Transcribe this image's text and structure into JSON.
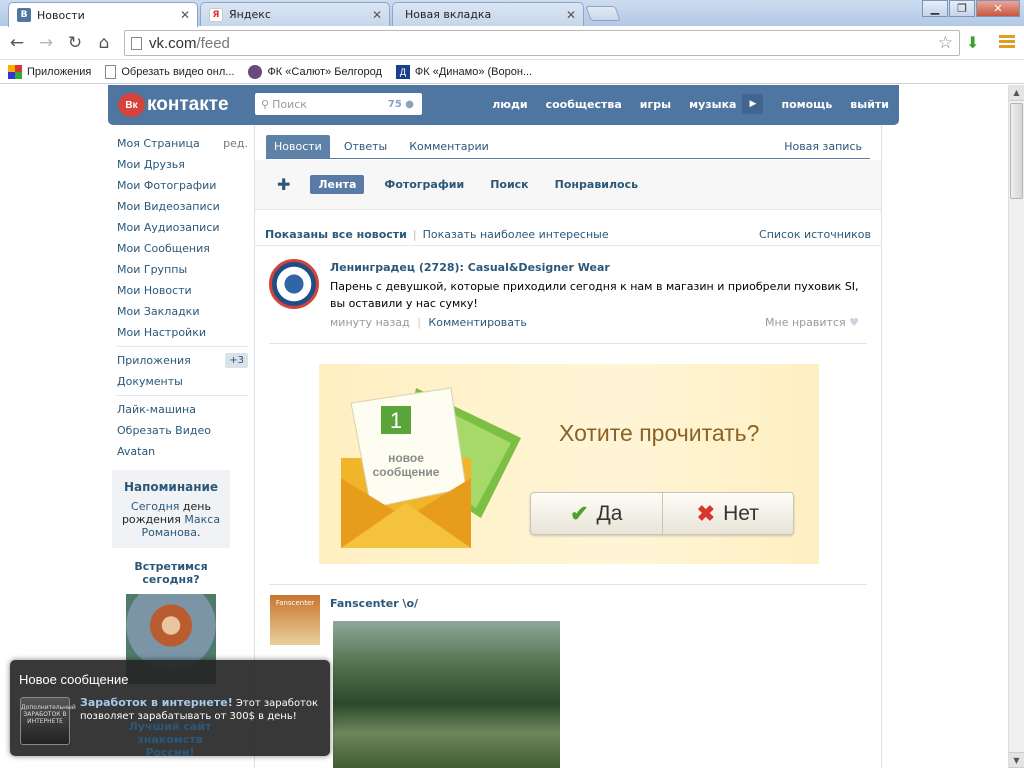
{
  "browser": {
    "tabs": [
      {
        "title": "Новости",
        "favicon": "vk-icon",
        "active": true
      },
      {
        "title": "Яндекс",
        "favicon": "yandex-icon",
        "active": false
      },
      {
        "title": "Новая вкладка",
        "favicon": "",
        "active": false
      }
    ],
    "url_host": "vk.com",
    "url_path": "/feed",
    "bookmarks": [
      {
        "label": "Приложения",
        "icon": "apps-grid-icon"
      },
      {
        "label": "Обрезать видео онл...",
        "icon": "page-icon"
      },
      {
        "label": "ФК «Салют» Белгород",
        "icon": "club-icon"
      },
      {
        "label": "ФК «Динамо» (Ворон...",
        "icon": "dynamo-icon"
      }
    ]
  },
  "vk": {
    "logo_text": "контакте",
    "logo_badge": "Вк",
    "search": {
      "placeholder": "Поиск",
      "count": "75"
    },
    "nav": [
      "люди",
      "сообщества",
      "игры",
      "музыка",
      "помощь",
      "выйти"
    ],
    "left_menu": {
      "primary": [
        "Моя Страница",
        "Мои Друзья",
        "Мои Фотографии",
        "Мои Видеозаписи",
        "Мои Аудиозаписи",
        "Мои Сообщения",
        "Мои Группы",
        "Мои Новости",
        "Мои Закладки",
        "Мои Настройки"
      ],
      "edit_label": "ред.",
      "apps_label": "Приложения",
      "apps_badge": "+3",
      "docs_label": "Документы",
      "extra": [
        "Лайк-машина",
        "Обрезать Видео",
        "Avatan"
      ]
    },
    "reminder": {
      "title": "Напоминание",
      "text_pre": "Сегодня",
      "text_mid": "день рождения",
      "name": "Макса Романова",
      "dot": "."
    },
    "meet": {
      "title": "Встретимся сегодня?"
    },
    "peek_text": "Лучший сайт знакомств России!",
    "tabs": [
      "Новости",
      "Ответы",
      "Комментарии"
    ],
    "new_post": "Новая запись",
    "sub_tabs": [
      "Лента",
      "Фотографии",
      "Поиск",
      "Понравилось"
    ],
    "filter": {
      "shown_all": "Показаны все новости",
      "interesting": "Показать наиболее интересные",
      "sources": "Список источников"
    },
    "post1": {
      "author": "Ленинградец (2728): Casual&Designer Wear",
      "text": "Парень с девушкой, которые приходили сегодня к нам в магазин и приобрели пуховик SI, вы оставили у нас сумку!",
      "time": "минуту назад",
      "comment": "Комментировать",
      "like": "Мне нравится"
    },
    "ad": {
      "badge_num": "1",
      "badge_text": "новое сообщение",
      "question": "Хотите прочитать?",
      "yes": "Да",
      "no": "Нет"
    },
    "post2": {
      "author": "Fanscenter \\o/",
      "avatar_text": "Fanscenter"
    }
  },
  "toast": {
    "title": "Новое сообщение",
    "icon_text": "Дополнительный ЗАРАБОТОК В ИНТЕРНЕТЕ",
    "link": "Заработок в интернете!",
    "text": "Этот заработок позволяет зарабатывать от 300$ в день!"
  },
  "colors": {
    "vk_blue": "#4f76a0",
    "link": "#2b587a",
    "accent_green": "#4ca22c",
    "accent_red": "#d9372d"
  }
}
